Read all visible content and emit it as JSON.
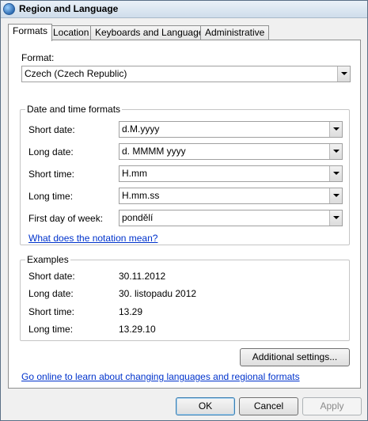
{
  "window": {
    "title": "Region and Language",
    "icon": "globe-icon"
  },
  "tabs": [
    {
      "label": "Formats",
      "active": true
    },
    {
      "label": "Location",
      "active": false
    },
    {
      "label": "Keyboards and Languages",
      "active": false
    },
    {
      "label": "Administrative",
      "active": false
    }
  ],
  "format": {
    "label": "Format:",
    "value": "Czech (Czech Republic)"
  },
  "date_time": {
    "title": "Date and time formats",
    "short_date": {
      "label": "Short date:",
      "value": "d.M.yyyy"
    },
    "long_date": {
      "label": "Long date:",
      "value": "d. MMMM yyyy"
    },
    "short_time": {
      "label": "Short time:",
      "value": "H.mm"
    },
    "long_time": {
      "label": "Long time:",
      "value": "H.mm.ss"
    },
    "first_day": {
      "label": "First day of week:",
      "value": "pondělí"
    },
    "notation_link": "What does the notation mean?"
  },
  "examples": {
    "title": "Examples",
    "short_date": {
      "label": "Short date:",
      "value": "30.11.2012"
    },
    "long_date": {
      "label": "Long date:",
      "value": "30. listopadu 2012"
    },
    "short_time": {
      "label": "Short time:",
      "value": "13.29"
    },
    "long_time": {
      "label": "Long time:",
      "value": "13.29.10"
    }
  },
  "additional_settings": "Additional settings...",
  "online_link": "Go online to learn about changing languages and regional formats",
  "buttons": {
    "ok": "OK",
    "cancel": "Cancel",
    "apply": "Apply"
  }
}
